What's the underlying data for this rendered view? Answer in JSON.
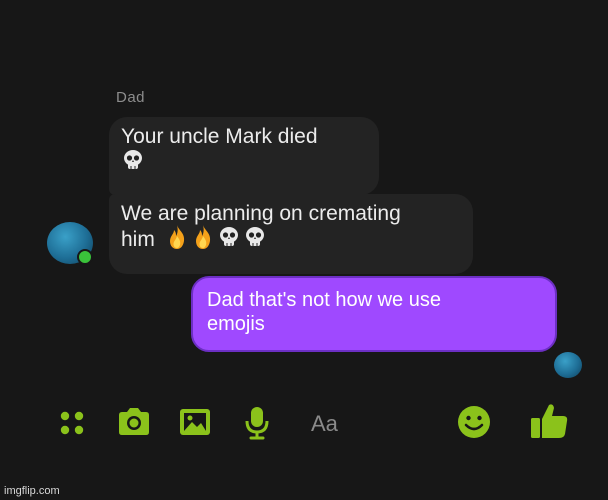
{
  "conversation": {
    "sender_name": "Dad",
    "messages_in": [
      {
        "text": "Your uncle Mark died",
        "emojis": [
          "skull"
        ]
      },
      {
        "text_line1": "We are planning on cremating",
        "text_line2": "him",
        "emojis": [
          "fire",
          "fire",
          "skull",
          "skull"
        ]
      }
    ],
    "messages_out": [
      {
        "text_line1": "Dad that's not how we use",
        "text_line2": "emojis"
      }
    ]
  },
  "composer": {
    "placeholder": "Aa",
    "icons": [
      "apps-icon",
      "camera-icon",
      "image-icon",
      "microphone-icon",
      "emoji-icon",
      "thumbs-up-icon"
    ]
  },
  "colors": {
    "background": "#171717",
    "incoming_bubble": "#232323",
    "outgoing_bubble": "#9f49ff",
    "toolbar_accent": "#8bc21b",
    "online": "#3ac23a"
  },
  "watermark": "imgflip.com"
}
